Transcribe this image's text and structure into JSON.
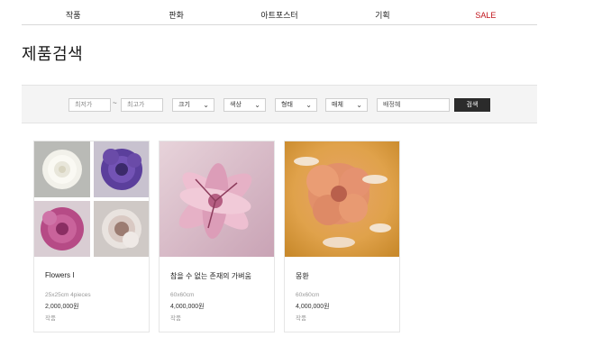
{
  "nav": {
    "items": [
      "작품",
      "판화",
      "아트포스터",
      "기획",
      "SALE"
    ]
  },
  "page": {
    "title": "제품검색"
  },
  "filters": {
    "min_price_placeholder": "최저가",
    "separator": "~",
    "max_price_placeholder": "최고가",
    "size_label": "크기",
    "color_label": "색상",
    "shape_label": "형태",
    "medium_label": "매체",
    "artist_value": "배정혜",
    "search_label": "검색"
  },
  "products": [
    {
      "name": "Flowers I",
      "size": "25x25cm 4pieces",
      "price": "2,000,000원",
      "category": "작품"
    },
    {
      "name": "참을 수 없는 존재의 가벼움",
      "size": "60x60cm",
      "price": "4,000,000원",
      "category": "작품"
    },
    {
      "name": "몽환",
      "size": "60x60cm",
      "price": "4,000,000원",
      "category": "작품"
    }
  ],
  "theme": {
    "sale_color": "#c0141b",
    "button_color": "#2b2b2b"
  }
}
